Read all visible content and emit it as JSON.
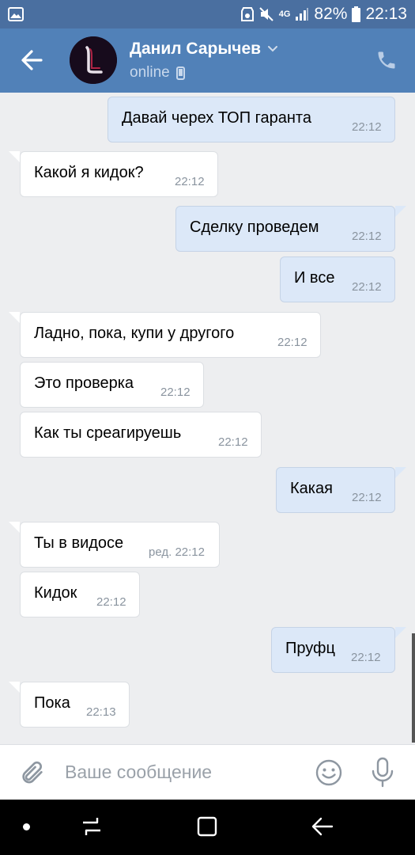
{
  "status_bar": {
    "battery_percent": "82%",
    "time": "22:13",
    "network": "4G"
  },
  "header": {
    "contact_name": "Данил Сарычев",
    "status": "online",
    "avatar_letter": "L"
  },
  "messages": [
    {
      "direction": "out",
      "text": "Давай черех ТОП гаранта",
      "time": "22:12"
    },
    {
      "direction": "in",
      "text": "Какой я кидок?",
      "time": "22:12"
    },
    {
      "direction": "out",
      "text": "Сделку проведем",
      "time": "22:12"
    },
    {
      "direction": "out",
      "text": "И все",
      "time": "22:12"
    },
    {
      "direction": "in",
      "text": "Ладно, пока, купи у другого",
      "time": "22:12"
    },
    {
      "direction": "in",
      "text": "Это проверка",
      "time": "22:12"
    },
    {
      "direction": "in",
      "text": "Как ты среагируешь",
      "time": "22:12"
    },
    {
      "direction": "out",
      "text": "Какая",
      "time": "22:12"
    },
    {
      "direction": "in",
      "text": "Ты в видосе",
      "time": "ред. 22:12"
    },
    {
      "direction": "in",
      "text": "Кидок",
      "time": "22:12"
    },
    {
      "direction": "out",
      "text": "Пруфц",
      "time": "22:12"
    },
    {
      "direction": "in",
      "text": "Пока",
      "time": "22:13"
    }
  ],
  "input": {
    "placeholder": "Ваше сообщение",
    "value": ""
  },
  "icons": {
    "back": "arrow-left-icon",
    "call": "phone-icon",
    "attach": "paperclip-icon",
    "emoji": "smile-icon",
    "voice": "microphone-icon"
  },
  "colors": {
    "header": "#5181b8",
    "status_bar": "#4a6fa0",
    "outgoing_bubble": "#dce8f8",
    "incoming_bubble": "#ffffff",
    "chat_background": "#edeef0"
  }
}
